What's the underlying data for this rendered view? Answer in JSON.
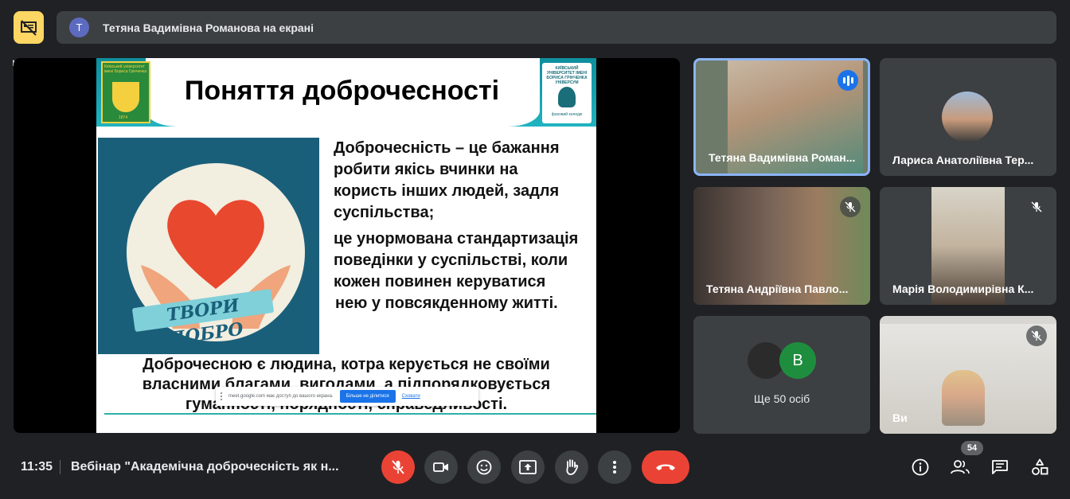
{
  "top_bar": {
    "presenter_initial": "Т",
    "presenter_text": "Тетяна Вадимівна Романова на екрані"
  },
  "slide": {
    "title": "Поняття доброчесності",
    "logo_left_text": "Київський університет імені Бориса Грінченка",
    "logo_left_year": "1874",
    "logo_right_text": "КИЇВСЬКИЙ УНІВЕРСИТЕТ ІМЕНІ БОРИСА ГРІНЧЕНКА УНІВЕРСУМ",
    "logo_right_sub": "фаховий коледж",
    "art_banner": "ТВОРИ ДОБРО",
    "text_block_1": [
      "Доброчесність – це бажання",
      "робити якісь вчинки на",
      "користь інших людей, задля",
      "суспільства;"
    ],
    "text_block_2": [
      "це унормована стандартизація",
      "поведінки у суспільстві, коли",
      "кожен повинен керуватися",
      "нею у повсякденному житті."
    ],
    "bottom_lines": [
      "Доброчесною є людина, котра керується не своїми",
      "власними благами, вигодами, а підпорядковується",
      "гуманності, порядності, справедливості."
    ]
  },
  "share_bar": {
    "message": "meet.google.com має доступ до вашого екрана.",
    "stop_label": "Більше не ділитися",
    "hide_label": "Сховати"
  },
  "tiles": [
    {
      "name": "Тетяна Вадимівна Роман...",
      "state": "speaking"
    },
    {
      "name": "Лариса Анатоліївна Тер...",
      "state": "avatar"
    },
    {
      "name": "Тетяна Андріївна Павло...",
      "state": "muted"
    },
    {
      "name": "Марія Володимирівна К...",
      "state": "muted"
    },
    {
      "more_initial": "В",
      "more_text": "Ще 50 осіб"
    },
    {
      "name": "Ви",
      "state": "muted"
    }
  ],
  "bottom_bar": {
    "time": "11:35",
    "meeting_title": "Вебінар \"Академічна доброчесність як н...",
    "participant_count": "54"
  },
  "icons": {
    "mic": "mic-off-icon",
    "camera": "videocam-icon",
    "emoji": "emoji-icon",
    "present": "present-screen-icon",
    "raise_hand": "raise-hand-icon",
    "more": "more-vert-icon",
    "end_call": "end-call-icon",
    "info": "info-icon",
    "people": "people-icon",
    "chat": "chat-icon",
    "activities": "activities-icon"
  },
  "colors": {
    "background": "#202124",
    "surface": "#3c4043",
    "accent_blue": "#1a73e8",
    "danger": "#ea4335",
    "present_highlight": "#fdd663"
  }
}
